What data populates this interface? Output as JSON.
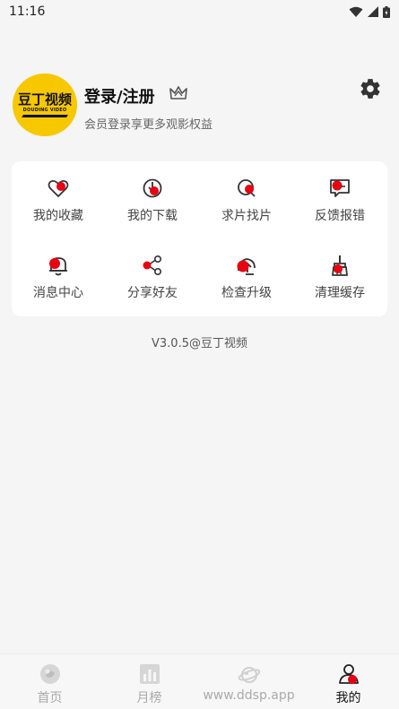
{
  "status_bar": {
    "time": "11:16"
  },
  "profile": {
    "avatar_title": "豆丁视频",
    "avatar_subtitle": "DOUDING VIDEO",
    "login_label": "登录/注册",
    "subtitle": "会员登录享更多观影权益"
  },
  "menu": {
    "items": [
      {
        "label": "我的收藏",
        "icon": "heart-icon"
      },
      {
        "label": "我的下载",
        "icon": "download-icon"
      },
      {
        "label": "求片找片",
        "icon": "search-film-icon"
      },
      {
        "label": "反馈报错",
        "icon": "feedback-icon"
      },
      {
        "label": "消息中心",
        "icon": "bell-icon"
      },
      {
        "label": "分享好友",
        "icon": "share-icon"
      },
      {
        "label": "检查升级",
        "icon": "upgrade-icon"
      },
      {
        "label": "清理缓存",
        "icon": "broom-icon"
      }
    ]
  },
  "version": "V3.0.5@豆丁视频",
  "bottom_nav": {
    "items": [
      {
        "label": "首页",
        "active": false
      },
      {
        "label": "月榜",
        "active": false
      },
      {
        "label": "www.ddsp.app",
        "active": false
      },
      {
        "label": "我的",
        "active": true
      }
    ]
  },
  "colors": {
    "accent": "#e60012",
    "avatar_bg": "#f7c800"
  }
}
